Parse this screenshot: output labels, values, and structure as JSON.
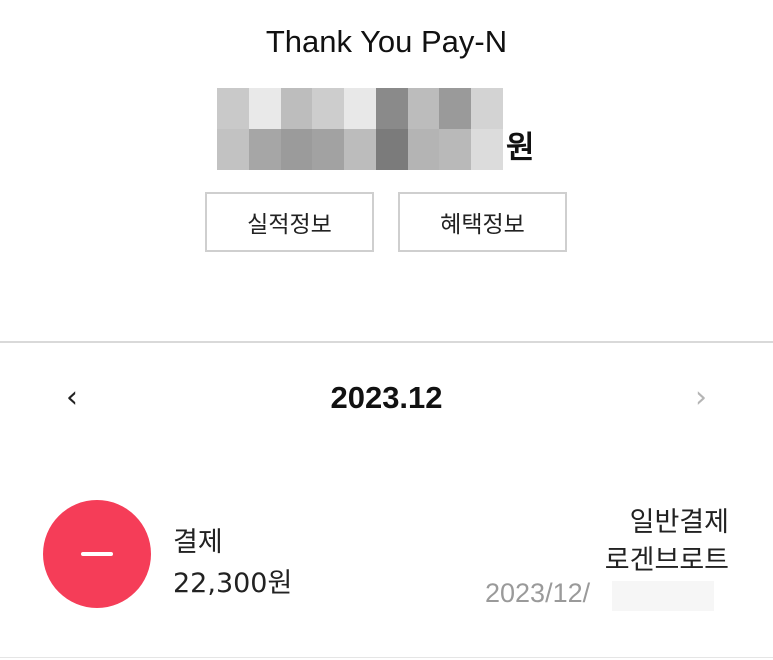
{
  "card": {
    "title": "Thank You Pay-N",
    "amount_unit": "원"
  },
  "buttons": {
    "performance": "실적정보",
    "benefit": "혜택정보"
  },
  "month_nav": {
    "current": "2023.12",
    "prev_icon": "chevron-left-icon",
    "next_icon": "chevron-right-icon"
  },
  "transactions": [
    {
      "icon": "minus-icon",
      "icon_color": "#f53d58",
      "type": "결제",
      "amount": "22,300원",
      "method": "일반결제",
      "merchant": "로겐브로트",
      "date": "2023/12/"
    }
  ]
}
